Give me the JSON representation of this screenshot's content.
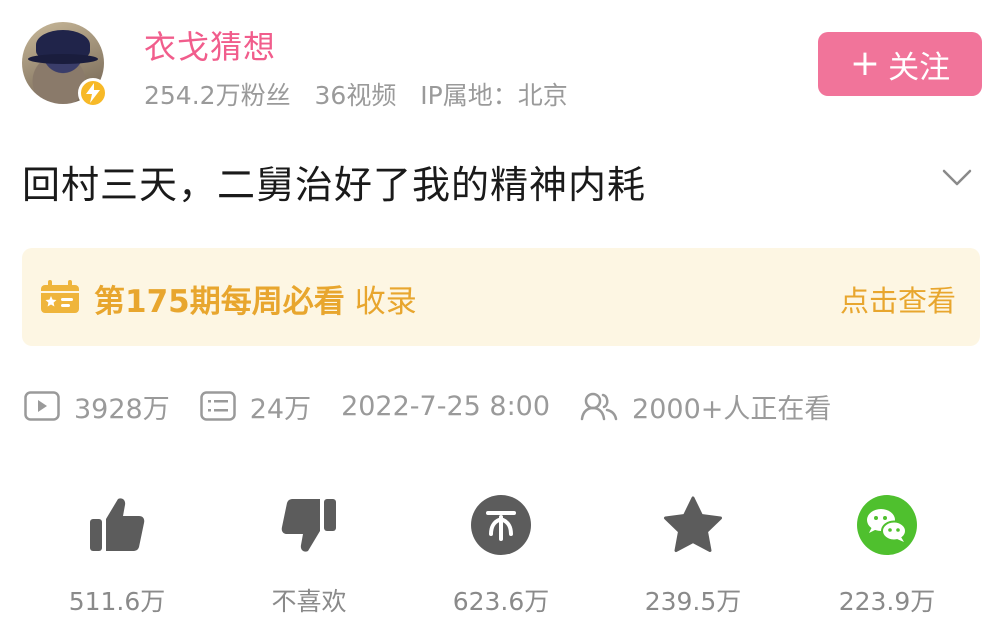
{
  "author": {
    "name": "衣戈猜想",
    "fans": "254.2万粉丝",
    "videos": "36视频",
    "ip": "IP属地：北京",
    "avatar_icon": "user-avatar",
    "badge_icon": "lightning-icon"
  },
  "follow_button": {
    "plus": "+",
    "label": "关注"
  },
  "video": {
    "title": "回村三天，二舅治好了我的精神内耗",
    "expand_icon": "chevron-down-icon"
  },
  "banner": {
    "title": "第175期每周必看",
    "subtitle": "收录",
    "link": "点击查看",
    "icon": "calendar-star-icon"
  },
  "stats": {
    "plays": "3928万",
    "danmaku": "24万",
    "date": "2022-7-25 8:00",
    "watching": "2000+人正在看"
  },
  "actions": [
    {
      "icon": "thumbs-up-icon",
      "label": "511.6万"
    },
    {
      "icon": "thumbs-down-icon",
      "label": "不喜欢"
    },
    {
      "icon": "coin-icon",
      "label": "623.6万"
    },
    {
      "icon": "star-icon",
      "label": "239.5万"
    },
    {
      "icon": "wechat-icon",
      "label": "223.9万"
    }
  ],
  "colors": {
    "accent_pink": "#f15d8c",
    "follow_bg": "#f1749a",
    "banner_bg": "#fdf6e3",
    "banner_text": "#e8a62e",
    "icon_gray": "#5c5c5c",
    "wechat_green": "#4fc02e",
    "badge_yellow": "#f7b928"
  }
}
